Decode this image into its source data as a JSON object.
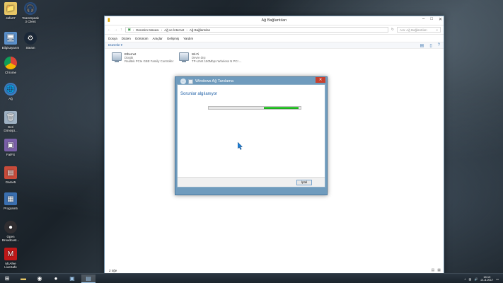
{
  "desktop": {
    "icons": [
      {
        "label": "Jafa37"
      },
      {
        "label": "TeamSpeak 3 Client"
      },
      {
        "label": "Bilgisayarım"
      },
      {
        "label": "Steam"
      },
      {
        "label": "Chrome"
      },
      {
        "label": "Ağ"
      },
      {
        "label": "Geri Dönüşü..."
      },
      {
        "label": "FatFS"
      },
      {
        "label": "Game5"
      },
      {
        "label": "Program5"
      },
      {
        "label": "Open Broadcast..."
      },
      {
        "label": "McAfee LiveSafe"
      }
    ]
  },
  "window": {
    "title": "Ağ Bağlantıları",
    "controls": [
      "–",
      "□",
      "✕"
    ],
    "address": {
      "segments": [
        "Denetim Masası",
        "Ağ ve İnternet",
        "Ağ Bağlantıları"
      ],
      "search_placeholder": "Ara: Ağ Bağlantıları"
    },
    "menu": [
      "Dosya",
      "Düzen",
      "Görünüm",
      "Araçlar",
      "Gelişmiş",
      "Yardım"
    ],
    "command": {
      "organize": "Düzenle ▾"
    },
    "adapters": [
      {
        "name": "Ethernet",
        "status": "Düşük",
        "device": "Realtek PCIe GBE Family Controller"
      },
      {
        "name": "Wi-Fi",
        "status": "Devre dışı",
        "device": "TP-LINK 150Mbps Wireless N PCI ..."
      }
    ],
    "status": {
      "count": "2 öğe"
    }
  },
  "dialog": {
    "title": "Windows Ağ Tanılama",
    "heading": "Sorunlar algılanıyor",
    "progress": 0.38,
    "button": "İptal"
  },
  "taskbar": {
    "time": "18:19",
    "date": "21.8.2017"
  },
  "colors": {
    "accent": "#1e5fa6",
    "dialog_frame": "#6f9bbd",
    "progress_fill": "#22b822",
    "close_red": "#c7402e"
  }
}
